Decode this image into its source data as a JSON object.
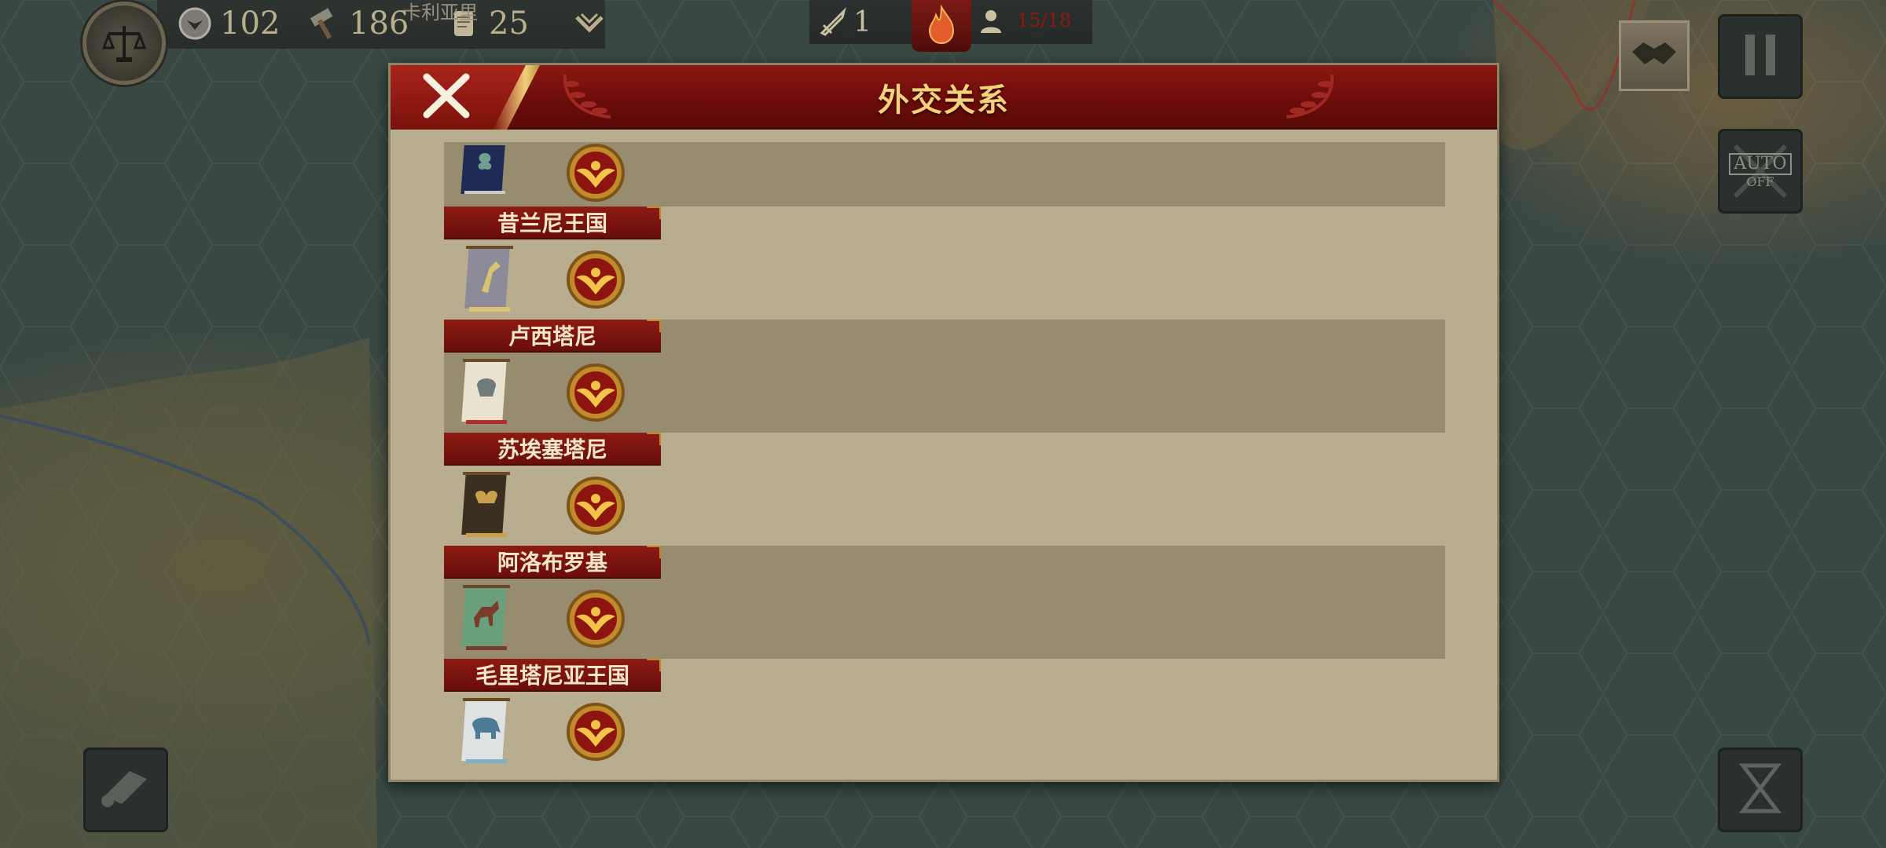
{
  "hud": {
    "res1_value": "102",
    "res2_value": "186",
    "res3_value": "25",
    "map_label": "卡利亚里",
    "turn_value": "1",
    "population": "15/18"
  },
  "right_controls": {
    "auto_label": "AUTO",
    "auto_state": "OFF"
  },
  "dialog": {
    "title": "外交关系",
    "close_icon": "close-x-icon"
  },
  "factions": [
    {
      "name": "",
      "banner_color": "#1f2a55",
      "banner_trim": "#c9c9c9",
      "banner_symbol": "clover"
    },
    {
      "name": "昔兰尼王国",
      "banner_color": "#8d8a99",
      "banner_trim": "#d8c473",
      "banner_symbol": "bird"
    },
    {
      "name": "卢西塔尼",
      "banner_color": "#e9e2cf",
      "banner_trim": "#b32d2d",
      "banner_symbol": "helmet"
    },
    {
      "name": "苏埃塞塔尼",
      "banner_color": "#3b2f22",
      "banner_trim": "#c9a14a",
      "banner_symbol": "torc"
    },
    {
      "name": "阿洛布罗基",
      "banner_color": "#6a9f7c",
      "banner_trim": "#7a3b2a",
      "banner_symbol": "horse"
    },
    {
      "name": "毛里塔尼亚王国",
      "banner_color": "#dfe2e2",
      "banner_trim": "#7bb0c6",
      "banner_symbol": "elephant"
    }
  ],
  "colors": {
    "dialog_red": "#8b1712",
    "title_gold": "#f2d17a",
    "row_dark": "#978c70",
    "row_light": "#b8ad8e"
  }
}
